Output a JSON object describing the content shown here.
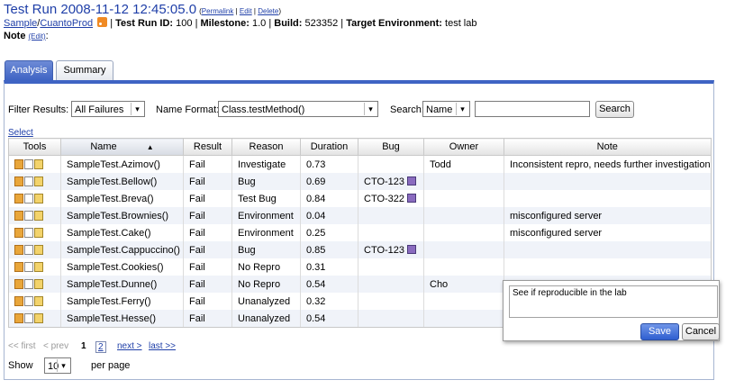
{
  "header": {
    "title": "Test Run 2008-11-12 12:45:05.0",
    "links": {
      "open": "(",
      "permalink": "Permalink",
      "sep1": " | ",
      "edit": "Edit",
      "sep2": " | ",
      "delete": "Delete",
      "close": ")"
    },
    "breadcrumb": {
      "sample": "Sample",
      "slash": "/",
      "product": "CuantoProd"
    },
    "info": {
      "run_id_label": "Test Run ID:",
      "run_id": "100",
      "milestone_label": "Milestone:",
      "milestone": "1.0",
      "build_label": "Build:",
      "build": "523352",
      "env_label": "Target Environment:",
      "env": "test lab"
    },
    "note_label": "Note",
    "note_edit": "(Edit)",
    "note_colon": ":"
  },
  "tabs": {
    "analysis": "Analysis",
    "summary": "Summary"
  },
  "filters": {
    "filter_label": "Filter Results:",
    "filter_value": "All Failures",
    "name_format_label": "Name Format:",
    "name_format_value": "Class.testMethod()",
    "search_label": "Search:",
    "search_field": "Name",
    "search_value": "",
    "search_button": "Search"
  },
  "select_link": "Select",
  "table": {
    "columns": [
      "Tools",
      "Name",
      "Result",
      "Reason",
      "Duration",
      "Bug",
      "Owner",
      "Note"
    ],
    "sort_indicator": "▲",
    "rows": [
      {
        "name": "SampleTest.Azimov()",
        "result": "Fail",
        "reason": "Investigate",
        "duration": "0.73",
        "bug": "",
        "owner": "Todd",
        "note": "Inconsistent repro, needs further investigation"
      },
      {
        "name": "SampleTest.Bellow()",
        "result": "Fail",
        "reason": "Bug",
        "duration": "0.69",
        "bug": "CTO-123",
        "owner": "",
        "note": ""
      },
      {
        "name": "SampleTest.Breva()",
        "result": "Fail",
        "reason": "Test Bug",
        "duration": "0.84",
        "bug": "CTO-322",
        "owner": "",
        "note": ""
      },
      {
        "name": "SampleTest.Brownies()",
        "result": "Fail",
        "reason": "Environment",
        "duration": "0.04",
        "bug": "",
        "owner": "",
        "note": "misconfigured server"
      },
      {
        "name": "SampleTest.Cake()",
        "result": "Fail",
        "reason": "Environment",
        "duration": "0.25",
        "bug": "",
        "owner": "",
        "note": "misconfigured server"
      },
      {
        "name": "SampleTest.Cappuccino()",
        "result": "Fail",
        "reason": "Bug",
        "duration": "0.85",
        "bug": "CTO-123",
        "owner": "",
        "note": ""
      },
      {
        "name": "SampleTest.Cookies()",
        "result": "Fail",
        "reason": "No Repro",
        "duration": "0.31",
        "bug": "",
        "owner": "",
        "note": ""
      },
      {
        "name": "SampleTest.Dunne()",
        "result": "Fail",
        "reason": "No Repro",
        "duration": "0.54",
        "bug": "",
        "owner": "Cho",
        "note": ""
      },
      {
        "name": "SampleTest.Ferry()",
        "result": "Fail",
        "reason": "Unanalyzed",
        "duration": "0.32",
        "bug": "",
        "owner": "",
        "note": ""
      },
      {
        "name": "SampleTest.Hesse()",
        "result": "Fail",
        "reason": "Unanalyzed",
        "duration": "0.54",
        "bug": "",
        "owner": "",
        "note": ""
      }
    ]
  },
  "pager": {
    "first": "<< first",
    "prev": "< prev",
    "page1": "1",
    "page2": "2",
    "next": "next >",
    "last": "last >>",
    "show_label": "Show",
    "per_page_value": "10",
    "per_page_label": "per page"
  },
  "note_editor": {
    "text": "See if reproducible in the lab",
    "save": "Save",
    "cancel": "Cancel"
  },
  "colors": {
    "accent": "#3f64c4",
    "link": "#1f3fa8",
    "row_alt": "#f0f3f9"
  },
  "icons": {
    "tools": [
      "folder-icon",
      "document-icon",
      "edit-icon"
    ],
    "bug_link": "external-link-icon",
    "rss": "rss-icon"
  }
}
